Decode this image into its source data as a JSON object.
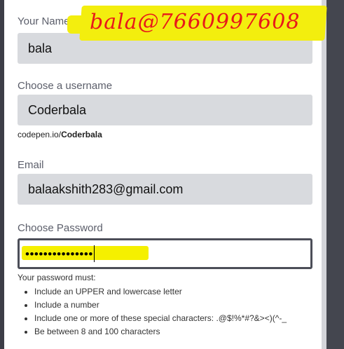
{
  "form": {
    "name": {
      "label": "Your Name",
      "value": "bala"
    },
    "username": {
      "label": "Choose a username",
      "value": "Coderbala",
      "url_prefix": "codepen.io/",
      "url_user": "Coderbala"
    },
    "email": {
      "label": "Email",
      "value": "balaakshith283@gmail.com"
    },
    "password": {
      "label": "Choose Password",
      "masked_value": "•••••••••••••••"
    },
    "password_rules": {
      "title": "Your password must:",
      "items": [
        "Include an UPPER and lowercase letter",
        "Include a number",
        "Include one or more of these special characters: .@$!%*#?&><)(^-_",
        "Be between 8 and 100 characters"
      ]
    }
  },
  "annotation": {
    "handwritten_text": "bala@7660997608",
    "color": "#e8181a",
    "highlight_color": "#f3ee0e"
  }
}
